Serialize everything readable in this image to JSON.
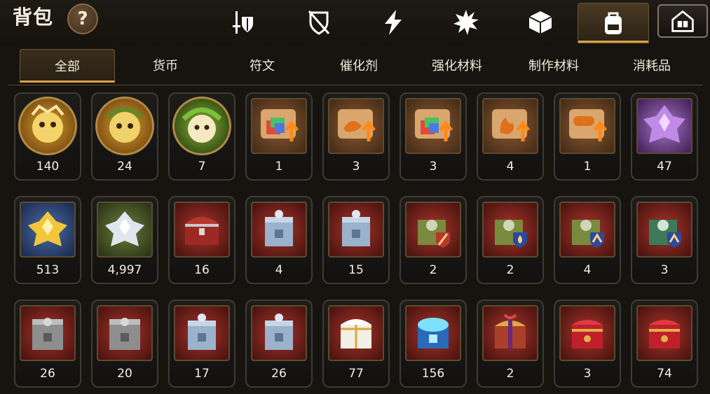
{
  "header": {
    "title": "背包",
    "help_label": "?",
    "tabs": [
      {
        "icon": "sword-shield-icon",
        "active": false
      },
      {
        "icon": "shield-slash-icon",
        "active": false
      },
      {
        "icon": "lightning-icon",
        "active": false
      },
      {
        "icon": "spiky-burst-icon",
        "active": false
      },
      {
        "icon": "cube-box-icon",
        "active": false
      },
      {
        "icon": "backpack-icon",
        "active": true
      }
    ],
    "shop_icon": "shop-house-icon"
  },
  "subtabs": [
    "全部",
    "货币",
    "符文",
    "催化剂",
    "强化材料",
    "制作材料",
    "消耗品"
  ],
  "active_subtab": 0,
  "items": [
    {
      "kind": "medal-gold",
      "count": "140"
    },
    {
      "kind": "medal-gold-leaf",
      "count": "24"
    },
    {
      "kind": "medal-green",
      "count": "7"
    },
    {
      "kind": "scroll-rainbow",
      "count": "1"
    },
    {
      "kind": "scroll-dragon",
      "count": "3"
    },
    {
      "kind": "scroll-rainbow",
      "count": "3"
    },
    {
      "kind": "scroll-flame",
      "count": "4"
    },
    {
      "kind": "scroll-exp",
      "count": "1"
    },
    {
      "kind": "crystal-purple",
      "count": "47"
    },
    {
      "kind": "crystal-gold",
      "count": "513"
    },
    {
      "kind": "crystal-silver",
      "count": "4,997"
    },
    {
      "kind": "chest-red",
      "count": "16"
    },
    {
      "kind": "chest-steel-blue",
      "count": "4"
    },
    {
      "kind": "chest-steel-blue",
      "count": "15"
    },
    {
      "kind": "chest-olive-sword",
      "count": "2"
    },
    {
      "kind": "chest-olive-drop",
      "count": "2"
    },
    {
      "kind": "chest-olive-wing",
      "count": "4"
    },
    {
      "kind": "chest-green-wing",
      "count": "3"
    },
    {
      "kind": "chest-grey",
      "count": "26"
    },
    {
      "kind": "chest-grey",
      "count": "20"
    },
    {
      "kind": "chest-steel-blue",
      "count": "17"
    },
    {
      "kind": "chest-steel-blue",
      "count": "26"
    },
    {
      "kind": "chest-white-gold",
      "count": "77"
    },
    {
      "kind": "chest-blue-glow",
      "count": "156"
    },
    {
      "kind": "chest-purple-gold",
      "count": "2"
    },
    {
      "kind": "chest-crimson",
      "count": "3"
    },
    {
      "kind": "chest-crimson",
      "count": "74"
    }
  ]
}
